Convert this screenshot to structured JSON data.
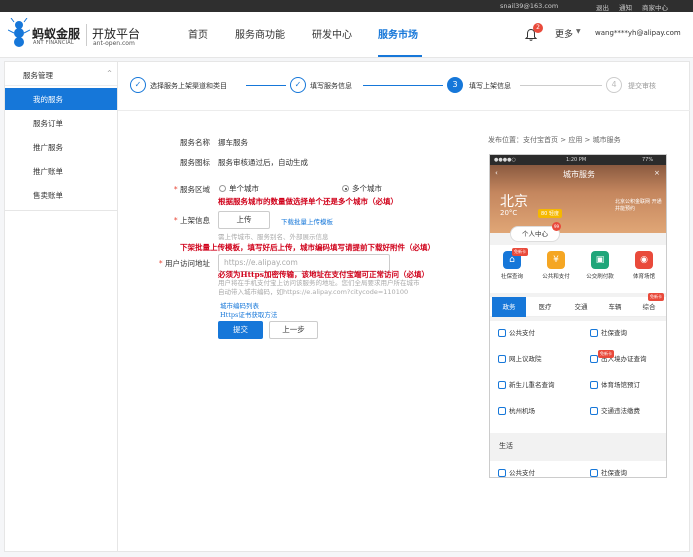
{
  "topbar": {
    "account": "snail39@163.com",
    "links": [
      "退出",
      "通知",
      "商家中心"
    ]
  },
  "header": {
    "brand_cn": "蚂蚁金服",
    "brand_en": "ANT FINANCIAL",
    "platform_cn": "开放平台",
    "platform_en": "ant-open.com",
    "nav": [
      "首页",
      "服务商功能",
      "研发中心",
      "服务市场"
    ],
    "notification_count": "2",
    "more_label": "更多",
    "user": "wang****yh@alipay.com"
  },
  "sidebar": {
    "group_label": "服务管理",
    "items": [
      "我的服务",
      "服务订单",
      "推广服务",
      "推广账单",
      "售卖账单"
    ]
  },
  "steps": [
    {
      "num": "1",
      "label": "选择服务上架渠道和类目"
    },
    {
      "num": "2",
      "label": "填写服务信息"
    },
    {
      "num": "3",
      "label": "填写上架信息"
    },
    {
      "num": "4",
      "label": "提交审核"
    }
  ],
  "form": {
    "service_name_label": "服务名称",
    "service_name_value": "挪车服务",
    "service_icon_label": "服务图标",
    "service_icon_value": "服务审核通过后，自动生成",
    "region_label": "服务区域",
    "region_single": "单个城市",
    "region_multi": "多个城市",
    "listing_label": "上架信息",
    "upload_button": "上传",
    "download_template": "下载批量上传模板",
    "listing_hint": "需上传城市、服务别名、外部展示信息",
    "url_label": "用户访问地址",
    "url_placeholder": "https://e.alipay.com",
    "url_hint_line1": "用户将在手机支付宝上访问该服务的地址。您们全局要求用户所在城市",
    "url_hint_line2": "自动带入城市编码，如https://e.alipay.com?citycode=110100",
    "city_code_link": "城市编码列表",
    "https_link": "Https证书获取方法",
    "submit_button": "提交",
    "prev_button": "上一步"
  },
  "annotations": {
    "region_note": "根据服务城市的数量做选择单个还是多个城市（必填）",
    "upload_note": "下架批量上传模板，填写好后上传，城市编码填写请提前下载好附件（必填）",
    "https_note": "必须为Https加密传输，该地址在支付宝端可正常访问（必填）"
  },
  "preview": {
    "position_label": "发布位置：支付宝首页 > 应用 > 城市服务",
    "status_time": "1:20 PM",
    "status_battery": "77%",
    "title": "城市服务",
    "city": "北京",
    "temperature": "20°C",
    "aqi": "80 轻度",
    "side_text": "北京公积金联网 开通并能预约",
    "personal_center": "个人中心",
    "personal_badge": "99",
    "new_tag": "免新卡",
    "top_icons": [
      "社保查询",
      "公共和支付",
      "公交刷付款",
      "体育场馆"
    ],
    "tabs": [
      "政务",
      "医疗",
      "交通",
      "车辆",
      "综合"
    ],
    "tab_tag": "免新卡",
    "list_items": [
      "公共支付",
      "社保查询",
      "网上议政院",
      "出入境办证查询",
      "新生儿重名查询",
      "体育场馆预订",
      "杭州机场",
      "交通违法缴费"
    ],
    "list_tag": "免新卡",
    "section2": "生活",
    "list2_items": [
      "公共支付",
      "社保查询"
    ]
  },
  "colors": {
    "accent": "#1677d9",
    "annotation": "#d0021b",
    "badge": "#e94a3b"
  }
}
